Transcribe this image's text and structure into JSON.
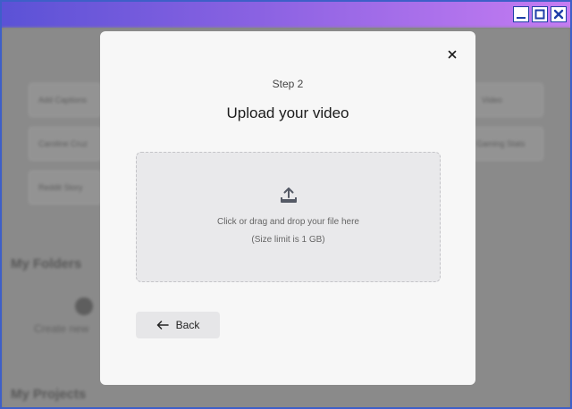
{
  "background": {
    "cards_left": [
      "Add Captions",
      "Caroline Cruz",
      "Reddit Story"
    ],
    "cards_right": [
      "Video",
      "Gaming Stats"
    ],
    "folders_heading": "My Folders",
    "create_new_caption": "Create new",
    "projects_heading": "My Projects"
  },
  "modal": {
    "step_label": "Step 2",
    "title": "Upload your video",
    "dropzone": {
      "primary_text": "Click or drag and drop your file here",
      "limit_text": "(Size limit is 1 GB)"
    },
    "back_label": "Back"
  },
  "icons": {
    "close": "close-icon",
    "upload": "upload-icon",
    "back": "arrow-left-icon",
    "minimize": "minimize-icon",
    "maximize": "maximize-icon",
    "window_close": "window-close-icon"
  },
  "colors": {
    "titlebar_start": "#5b52d6",
    "titlebar_end": "#c57cf2",
    "window_border": "#3e5fc8",
    "modal_bg": "#f7f7f7",
    "dropzone_bg": "#e9e9eb",
    "overlay": "#7d7d7d"
  }
}
